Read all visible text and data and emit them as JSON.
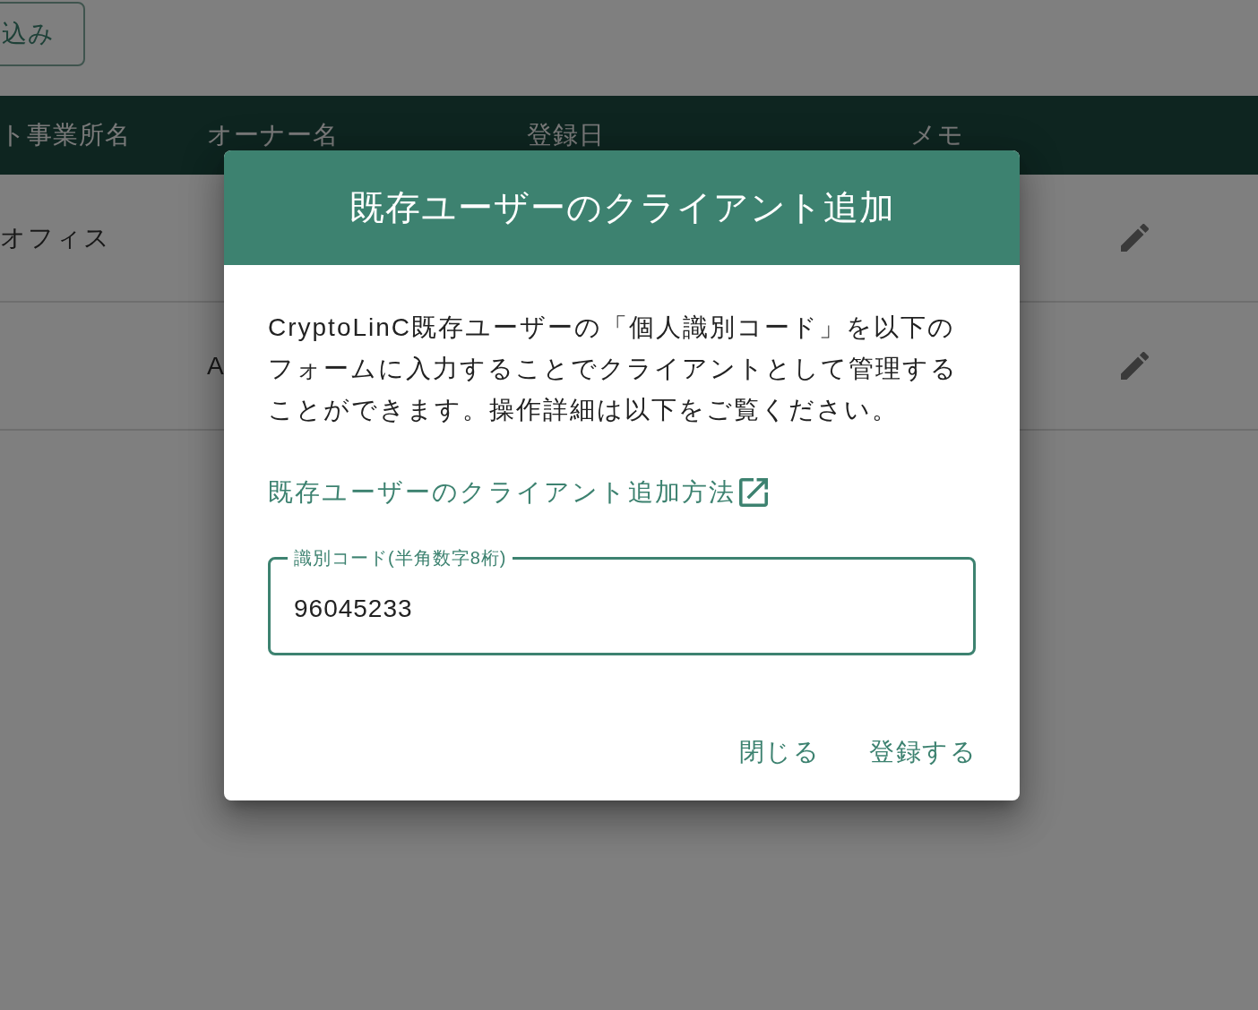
{
  "toolbar": {
    "filter_button": "込み"
  },
  "table": {
    "columns": [
      "ト事業所名",
      "オーナー名",
      "登録日",
      "メモ"
    ],
    "rows": [
      {
        "office": "オフィス"
      },
      {
        "owner": "A"
      }
    ]
  },
  "dialog": {
    "title": "既存ユーザーのクライアント追加",
    "description": "CryptoLinC既存ユーザーの「個人識別コード」を以下のフォームに入力することでクライアントとして管理することができます。操作詳細は以下をご覧ください。",
    "help_link": {
      "label": "既存ユーザーのクライアント追加方法"
    },
    "code_field": {
      "label": "識別コード(半角数字8桁)",
      "value": "96045233",
      "focused": true
    },
    "buttons": [
      {
        "label": "閉じる"
      },
      {
        "label": "登録する"
      }
    ]
  }
}
